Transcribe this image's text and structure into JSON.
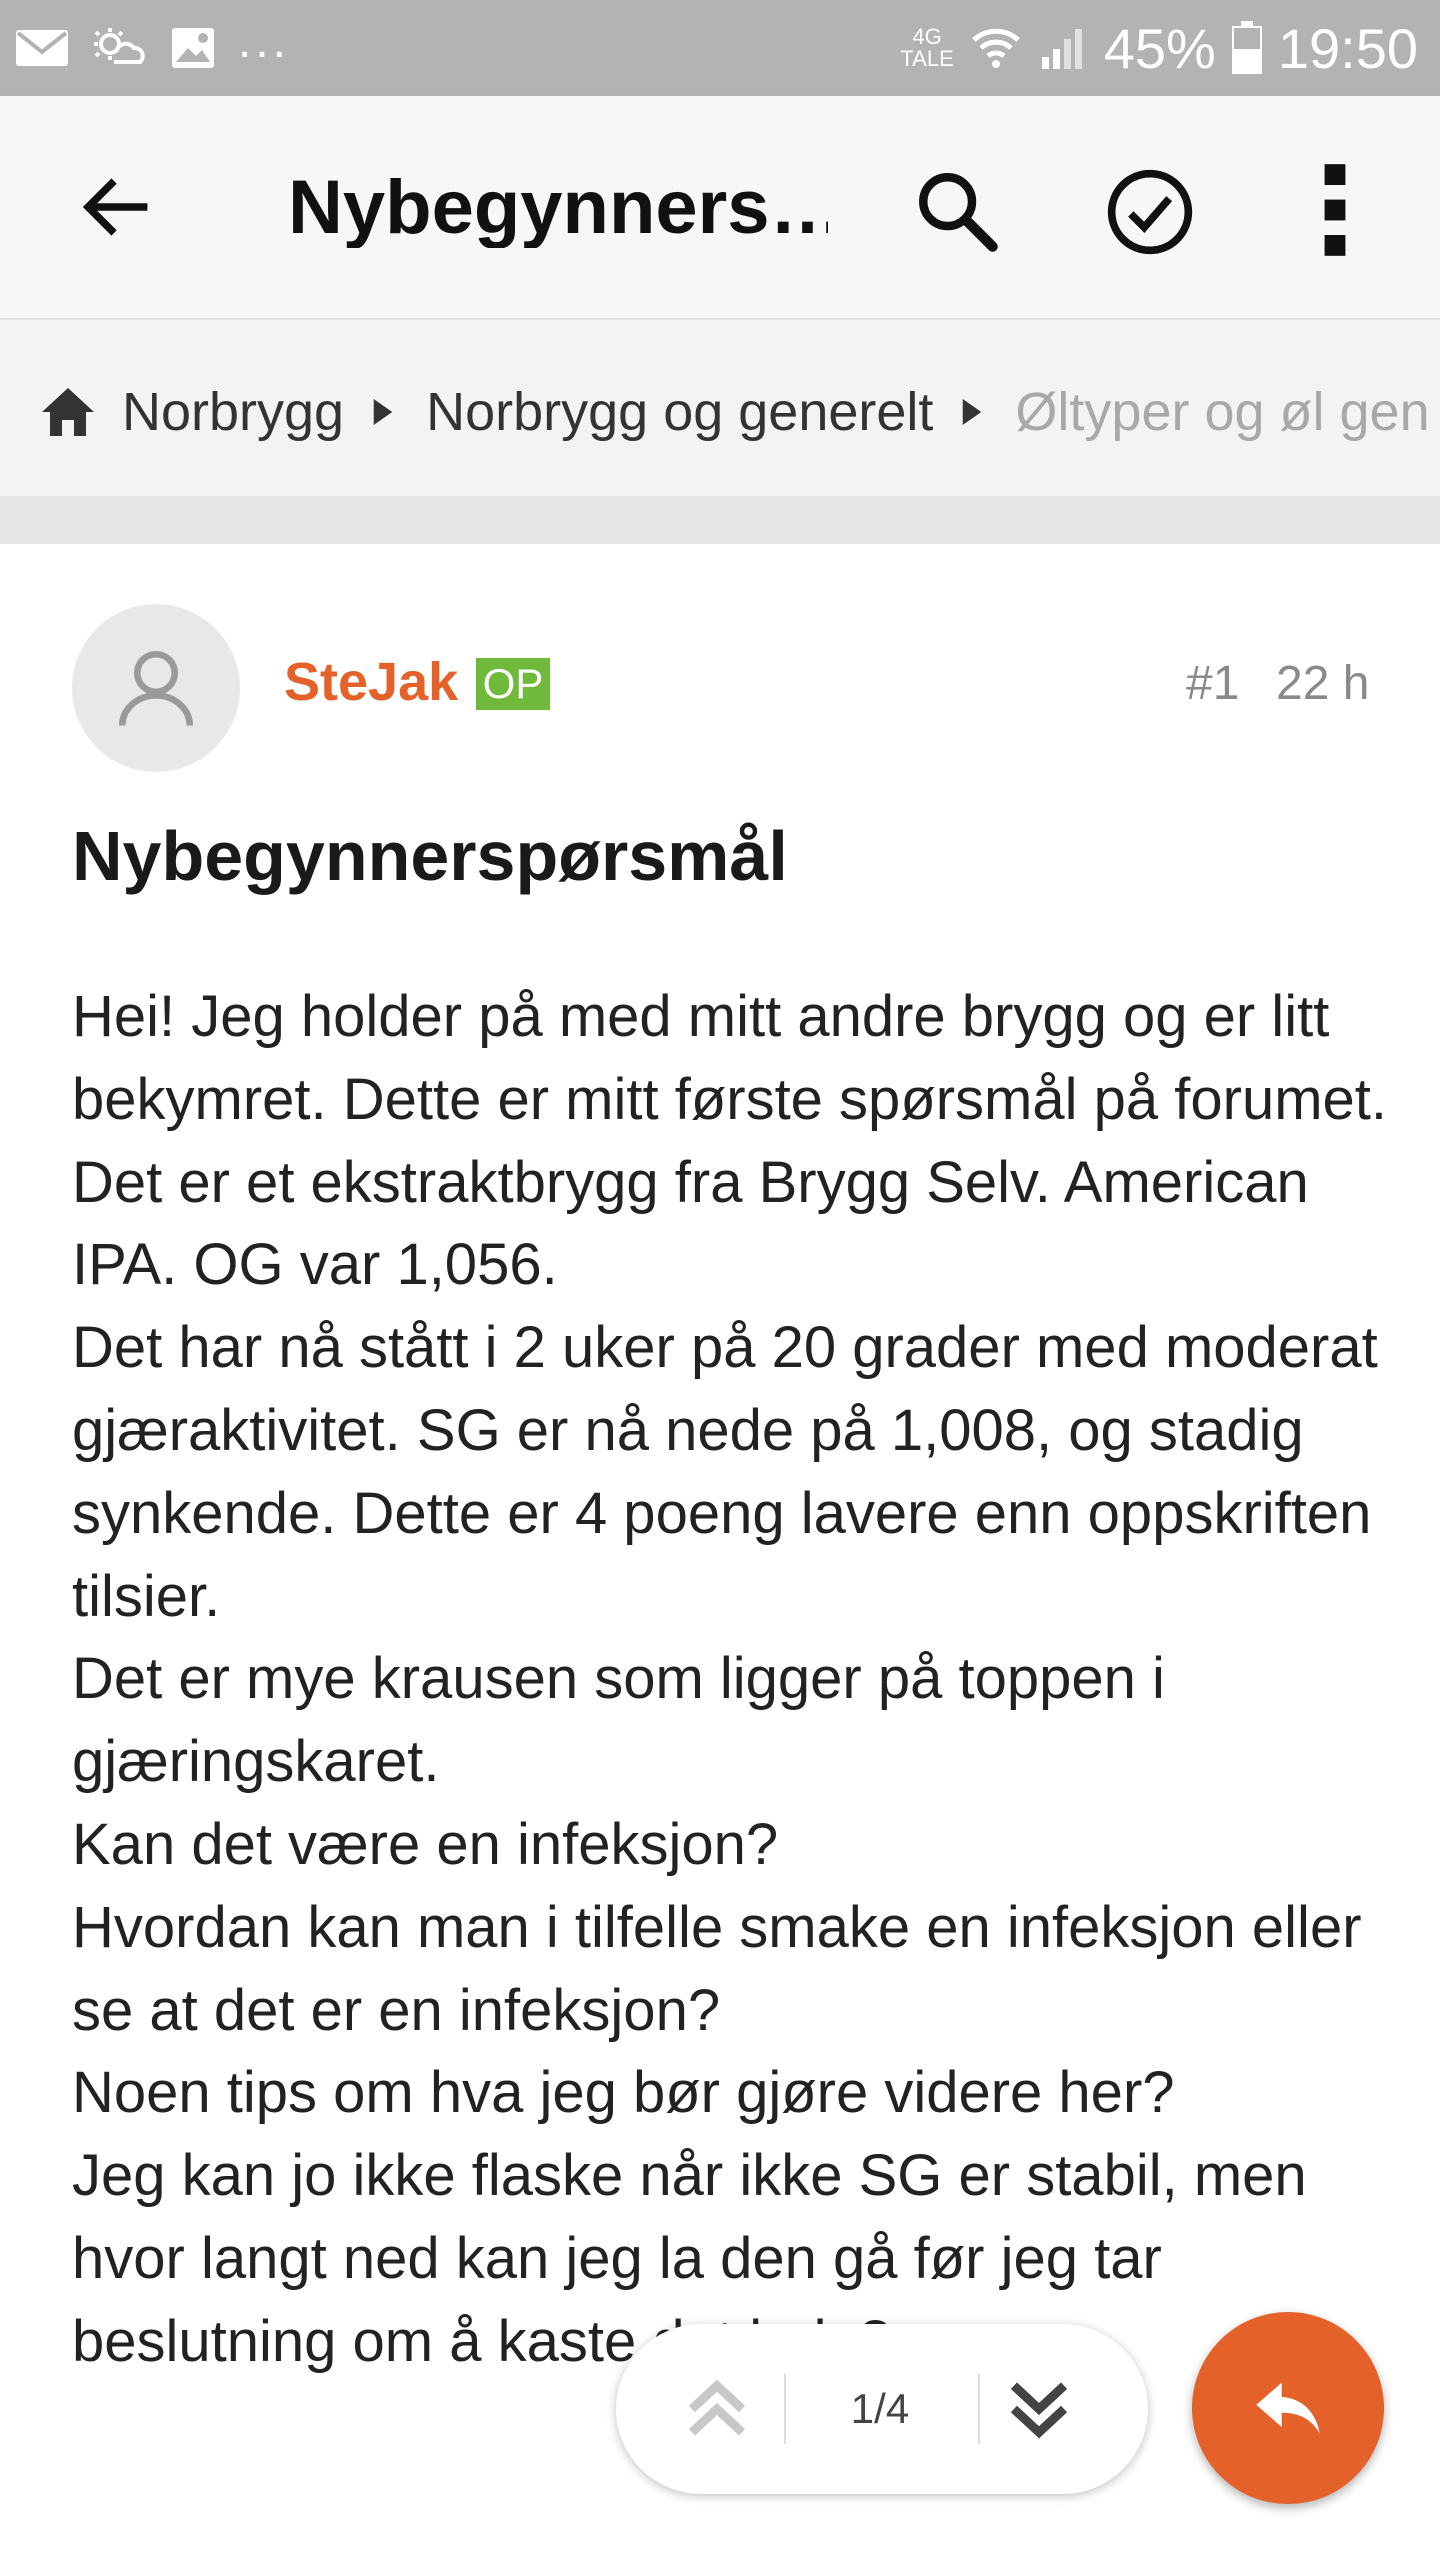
{
  "status_bar": {
    "network_top": "4G",
    "network_bottom": "TALE",
    "battery": "45%",
    "time": "19:50",
    "more_indicator": "..."
  },
  "app_bar": {
    "title": "Nybegynners…",
    "icons": [
      "back-arrow-icon",
      "search-icon",
      "check-circle-icon",
      "more-vert-icon"
    ]
  },
  "breadcrumb": {
    "items": [
      "Norbrygg",
      "Norbrygg og generelt",
      "Øltyper og øl gen"
    ]
  },
  "post": {
    "author": "SteJak",
    "badge": "OP",
    "number": "#1",
    "time": "22 h",
    "title": "Nybegynnerspørsmål",
    "lines": [
      "Hei! Jeg holder på med mitt andre brygg og er litt bekymret. Dette er mitt første spørsmål på forumet.",
      "Det er et ekstraktbrygg fra Brygg Selv. American IPA. OG var 1,056.",
      "Det har nå stått i 2 uker på 20 grader med moderat gjæraktivitet. SG er nå nede på 1,008, og stadig synkende. Dette er 4 poeng lavere enn oppskriften tilsier.",
      "Det er mye krausen som ligger på toppen i gjæringskaret.",
      "Kan det være en infeksjon?",
      "Hvordan kan man i tilfelle smake en infeksjon eller se at det er en infeksjon?",
      "Noen tips om hva jeg bør gjøre videre her?",
      "Jeg kan jo ikke flaske når ikke SG er stabil, men hvor langt ned kan jeg la den gå før jeg tar beslutning om å kaste det hele?"
    ]
  },
  "pager": {
    "count": "1/4"
  },
  "colors": {
    "accent": "#e5612a",
    "op_badge": "#6fba3a",
    "status_bar": "#b3b3b3"
  }
}
